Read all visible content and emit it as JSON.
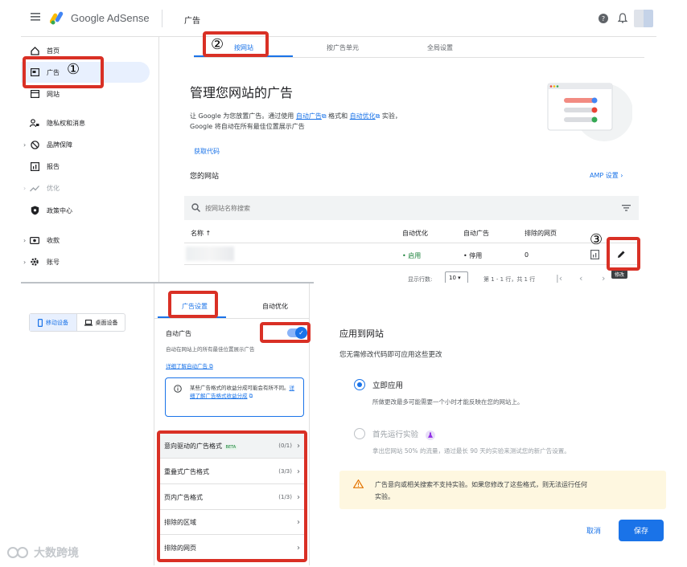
{
  "app": {
    "logo_text": "Google AdSense",
    "page_title": "广告"
  },
  "sidebar": {
    "items": [
      {
        "label": "首页"
      },
      {
        "label": "广告"
      },
      {
        "label": "网站"
      },
      {
        "label": "隐私权和消息"
      },
      {
        "label": "品牌保障"
      },
      {
        "label": "报告"
      },
      {
        "label": "优化"
      },
      {
        "label": "政策中心"
      },
      {
        "label": "收款"
      },
      {
        "label": "账号"
      }
    ]
  },
  "tabs": [
    {
      "label": "按网站"
    },
    {
      "label": "按广告单元"
    },
    {
      "label": "全局设置"
    }
  ],
  "main": {
    "heading": "管理您网站的广告",
    "desc_pre": "让 Google 为您放置广告。通过使用 ",
    "desc_link1": "自动广告",
    "desc_mid": " 格式和 ",
    "desc_link2": "自动优化",
    "desc_post": " 实验，",
    "desc_line2": "Google 将自动在所有最佳位置展示广告",
    "get_code": "获取代码",
    "your_sites": "您的网站",
    "amp_settings": "AMP 设置",
    "search_placeholder": "按网站名称搜索"
  },
  "table": {
    "headers": [
      "名称",
      "自动优化",
      "自动广告",
      "排除的网页"
    ],
    "row": {
      "auto_opt": "启用",
      "auto_ads": "停用",
      "excluded": "0"
    },
    "edit_tooltip": "修改",
    "rows_per_page_label": "显示行数:",
    "rows_per_page_value": "10",
    "page_range": "第 1 - 1 行，共 1 行"
  },
  "device_toggle": {
    "mobile": "移动设备",
    "desktop": "桌面设备"
  },
  "settings": {
    "tabs": [
      "广告设置",
      "自动优化"
    ],
    "auto_ads_label": "自动广告",
    "auto_ads_desc": "自动在网站上的所有最佳位置展示广告",
    "learn_more": "详细了解自动广告",
    "info_text": "某些广告格式的收益分成可能会有所不同。",
    "info_link": "详细了解广告格式收益分成",
    "rows": [
      {
        "label": "意向驱动的广告格式",
        "badge": "BETA",
        "count": "(0/1)"
      },
      {
        "label": "重叠式广告格式",
        "count": "(3/3)"
      },
      {
        "label": "页内广告格式",
        "count": "(1/3)"
      },
      {
        "label": "排除的区域",
        "count": ""
      },
      {
        "label": "排除的网页",
        "count": ""
      }
    ]
  },
  "apply": {
    "title": "应用到网站",
    "subtitle": "您无需修改代码即可应用这些更改",
    "opt1_title": "立即应用",
    "opt1_desc": "所做更改最多可能需要一个小时才能反映在您的网站上。",
    "opt2_title": "首先运行实验",
    "opt2_desc": "拿出您网站 50% 的流量，通过最长 90 天的实验来测试您的新广告设置。",
    "warning_line1": "广告意向或相关搜索不支持实验。如果您修改了这些格式，则无法运行任何",
    "warning_line2": "实验。",
    "cancel": "取消",
    "save": "保存"
  },
  "markers": [
    "①",
    "②",
    "③"
  ],
  "watermark": "大数跨境",
  "colors": {
    "accent": "#1a73e8",
    "highlight": "#d93025",
    "selected_bg": "#e8f0fe",
    "warning_bg": "#fef7e0",
    "green": "#188038"
  }
}
